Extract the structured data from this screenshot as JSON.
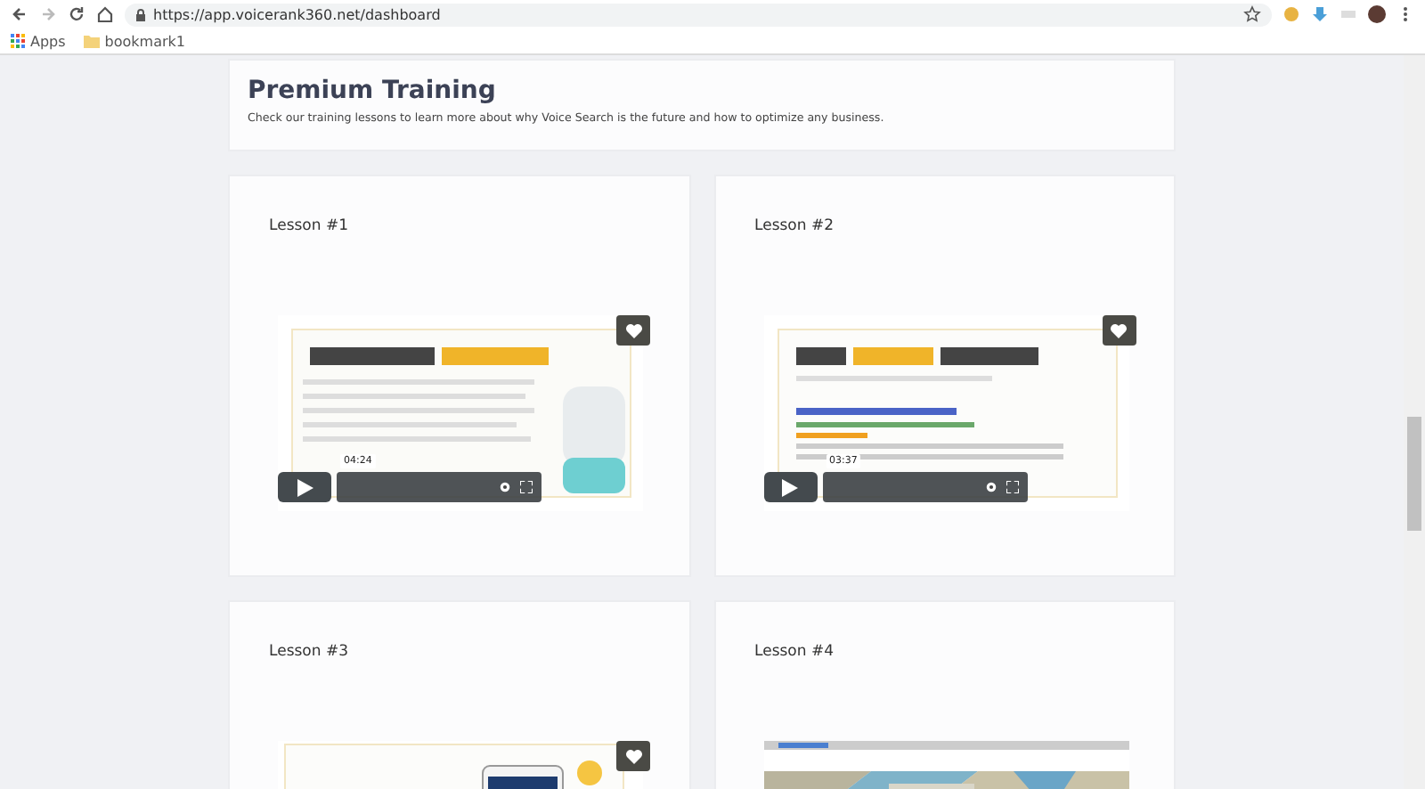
{
  "browser": {
    "url": "https://app.voicerank360.net/dashboard",
    "bookmarks": [
      {
        "label": "Apps"
      },
      {
        "label": "bookmark1"
      }
    ]
  },
  "header": {
    "title": "Premium Training",
    "description": "Check our training lessons to learn more about why Voice Search is the future and how to optimize any business."
  },
  "lessons": [
    {
      "title": "Lesson #1",
      "video": {
        "kind": "picture",
        "time": "04:24",
        "level": 0,
        "favorite": true
      }
    },
    {
      "title": "Lesson #2",
      "video": {
        "kind": "picture",
        "time": "03:37",
        "level": 0,
        "favorite": true
      }
    },
    {
      "title": "Lesson #3",
      "video": {
        "kind": "picture",
        "favorite": true
      }
    },
    {
      "title": "Lesson #4",
      "video": {
        "kind": "picture"
      }
    }
  ]
}
